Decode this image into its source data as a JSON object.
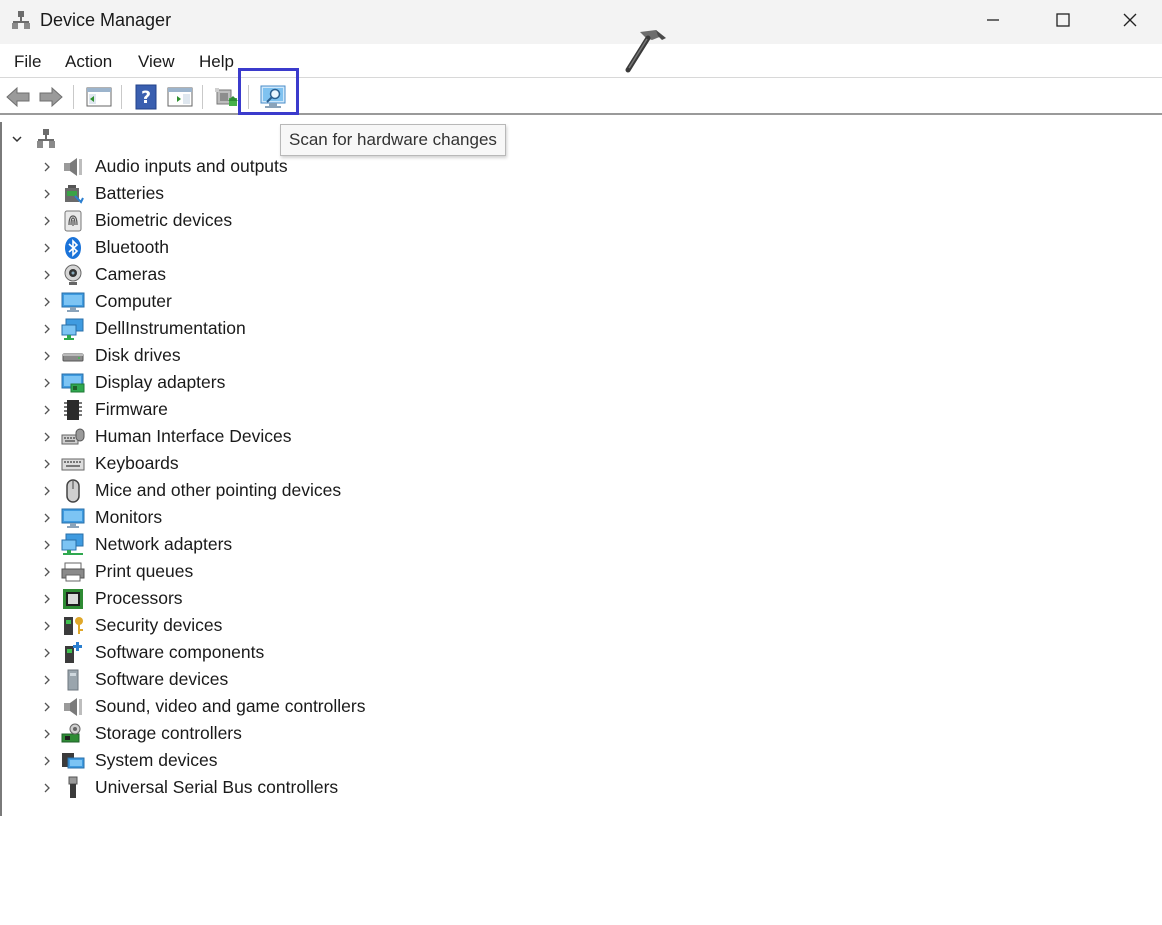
{
  "window": {
    "title": "Device Manager"
  },
  "menu": [
    "File",
    "Action",
    "View",
    "Help"
  ],
  "toolbar": {
    "tooltip": "Scan for hardware changes"
  },
  "tree": {
    "items": [
      {
        "label": "Audio inputs and outputs",
        "icon": "speaker-icon"
      },
      {
        "label": "Batteries",
        "icon": "battery-icon"
      },
      {
        "label": "Biometric devices",
        "icon": "fingerprint-icon"
      },
      {
        "label": "Bluetooth",
        "icon": "bluetooth-icon"
      },
      {
        "label": "Cameras",
        "icon": "camera-icon"
      },
      {
        "label": "Computer",
        "icon": "computer-icon"
      },
      {
        "label": "DellInstrumentation",
        "icon": "network-monitor-icon"
      },
      {
        "label": "Disk drives",
        "icon": "disk-drive-icon"
      },
      {
        "label": "Display adapters",
        "icon": "display-adapter-icon"
      },
      {
        "label": "Firmware",
        "icon": "firmware-chip-icon"
      },
      {
        "label": "Human Interface Devices",
        "icon": "hid-icon"
      },
      {
        "label": "Keyboards",
        "icon": "keyboard-icon"
      },
      {
        "label": "Mice and other pointing devices",
        "icon": "mouse-icon"
      },
      {
        "label": "Monitors",
        "icon": "monitor-icon"
      },
      {
        "label": "Network adapters",
        "icon": "network-adapter-icon"
      },
      {
        "label": "Print queues",
        "icon": "printer-icon"
      },
      {
        "label": "Processors",
        "icon": "processor-icon"
      },
      {
        "label": "Security devices",
        "icon": "security-key-icon"
      },
      {
        "label": "Software components",
        "icon": "software-component-icon"
      },
      {
        "label": "Software devices",
        "icon": "software-device-icon"
      },
      {
        "label": "Sound, video and game controllers",
        "icon": "sound-icon"
      },
      {
        "label": "Storage controllers",
        "icon": "storage-controller-icon"
      },
      {
        "label": "System devices",
        "icon": "system-devices-icon"
      },
      {
        "label": "Universal Serial Bus controllers",
        "icon": "usb-icon"
      }
    ]
  },
  "colors": {
    "highlight": "#3b3bcc",
    "accent": "#2e86de"
  }
}
